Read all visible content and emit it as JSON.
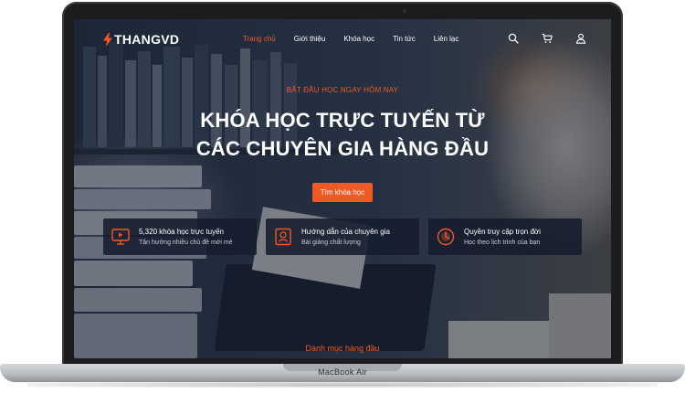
{
  "device": {
    "label": "MacBook Air"
  },
  "header": {
    "logo": {
      "text": "THANGVD",
      "icon": "lightning-bolt-icon",
      "icon_color": "#ef5a24"
    },
    "menu": [
      {
        "label": "Trang chủ",
        "active": true
      },
      {
        "label": "Giới thiệu",
        "active": false
      },
      {
        "label": "Khóa học",
        "active": false
      },
      {
        "label": "Tin tức",
        "active": false
      },
      {
        "label": "Liên lạc",
        "active": false
      }
    ],
    "icons": [
      "search-icon",
      "cart-icon",
      "user-icon"
    ]
  },
  "hero": {
    "kicker": "BẮT ĐẦU HỌC NGAY HÔM NAY",
    "headline_line1": "KHÓA HỌC TRỰC TUYẾN TỪ",
    "headline_line2": "CÁC CHUYÊN GIA HÀNG ĐẦU",
    "cta_label": "Tìm khóa học"
  },
  "features": [
    {
      "icon": "video-lesson-icon",
      "title": "5,320 khóa học trực tuyến",
      "subtitle": "Tận hưởng nhiều chủ đề mới mẻ"
    },
    {
      "icon": "expert-book-icon",
      "title": "Hướng dẫn của chuyên gia",
      "subtitle": "Bài giảng chất lượng"
    },
    {
      "icon": "clock-access-icon",
      "title": "Quyền truy cập trọn đời",
      "subtitle": "Học theo lịch trình của bạn"
    }
  ],
  "sections": {
    "top_categories": "Danh mục hàng đầu"
  },
  "colors": {
    "accent": "#ef5a24",
    "card_bg": "#141c2e",
    "text_light": "#ffffff"
  }
}
